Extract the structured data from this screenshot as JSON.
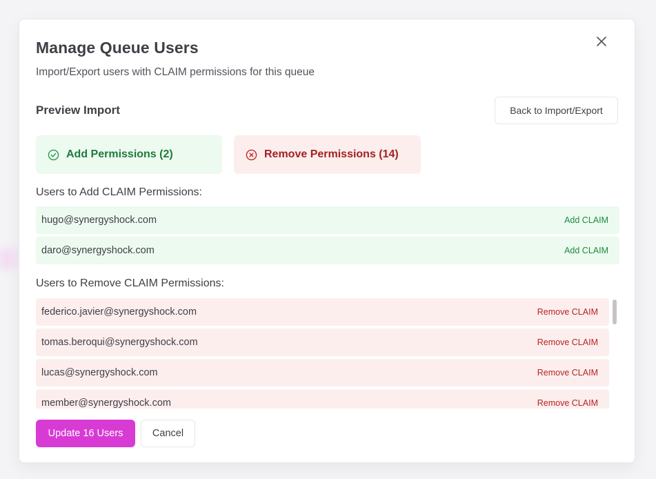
{
  "modal": {
    "title": "Manage Queue Users",
    "subtitle": "Import/Export users with CLAIM permissions for this queue",
    "close_icon": "close-icon"
  },
  "preview": {
    "title": "Preview Import",
    "back_label": "Back to Import/Export",
    "add_summary": "Add Permissions (2)",
    "remove_summary": "Remove Permissions (14)"
  },
  "add_section": {
    "label": "Users to Add CLAIM Permissions:",
    "rows": [
      {
        "email": "hugo@synergyshock.com",
        "action": "Add CLAIM"
      },
      {
        "email": "daro@synergyshock.com",
        "action": "Add CLAIM"
      }
    ]
  },
  "remove_section": {
    "label": "Users to Remove CLAIM Permissions:",
    "rows": [
      {
        "email": "federico.javier@synergyshock.com",
        "action": "Remove CLAIM"
      },
      {
        "email": "tomas.beroqui@synergyshock.com",
        "action": "Remove CLAIM"
      },
      {
        "email": "lucas@synergyshock.com",
        "action": "Remove CLAIM"
      },
      {
        "email": "member@synergyshock.com",
        "action": "Remove CLAIM"
      }
    ]
  },
  "footer": {
    "primary_label": "Update 16 Users",
    "cancel_label": "Cancel"
  },
  "colors": {
    "accent": "#d73bd4",
    "add_bg": "#ecfaf0",
    "add_text": "#1f7a3a",
    "remove_bg": "#fdeeee",
    "remove_text": "#a32020"
  }
}
